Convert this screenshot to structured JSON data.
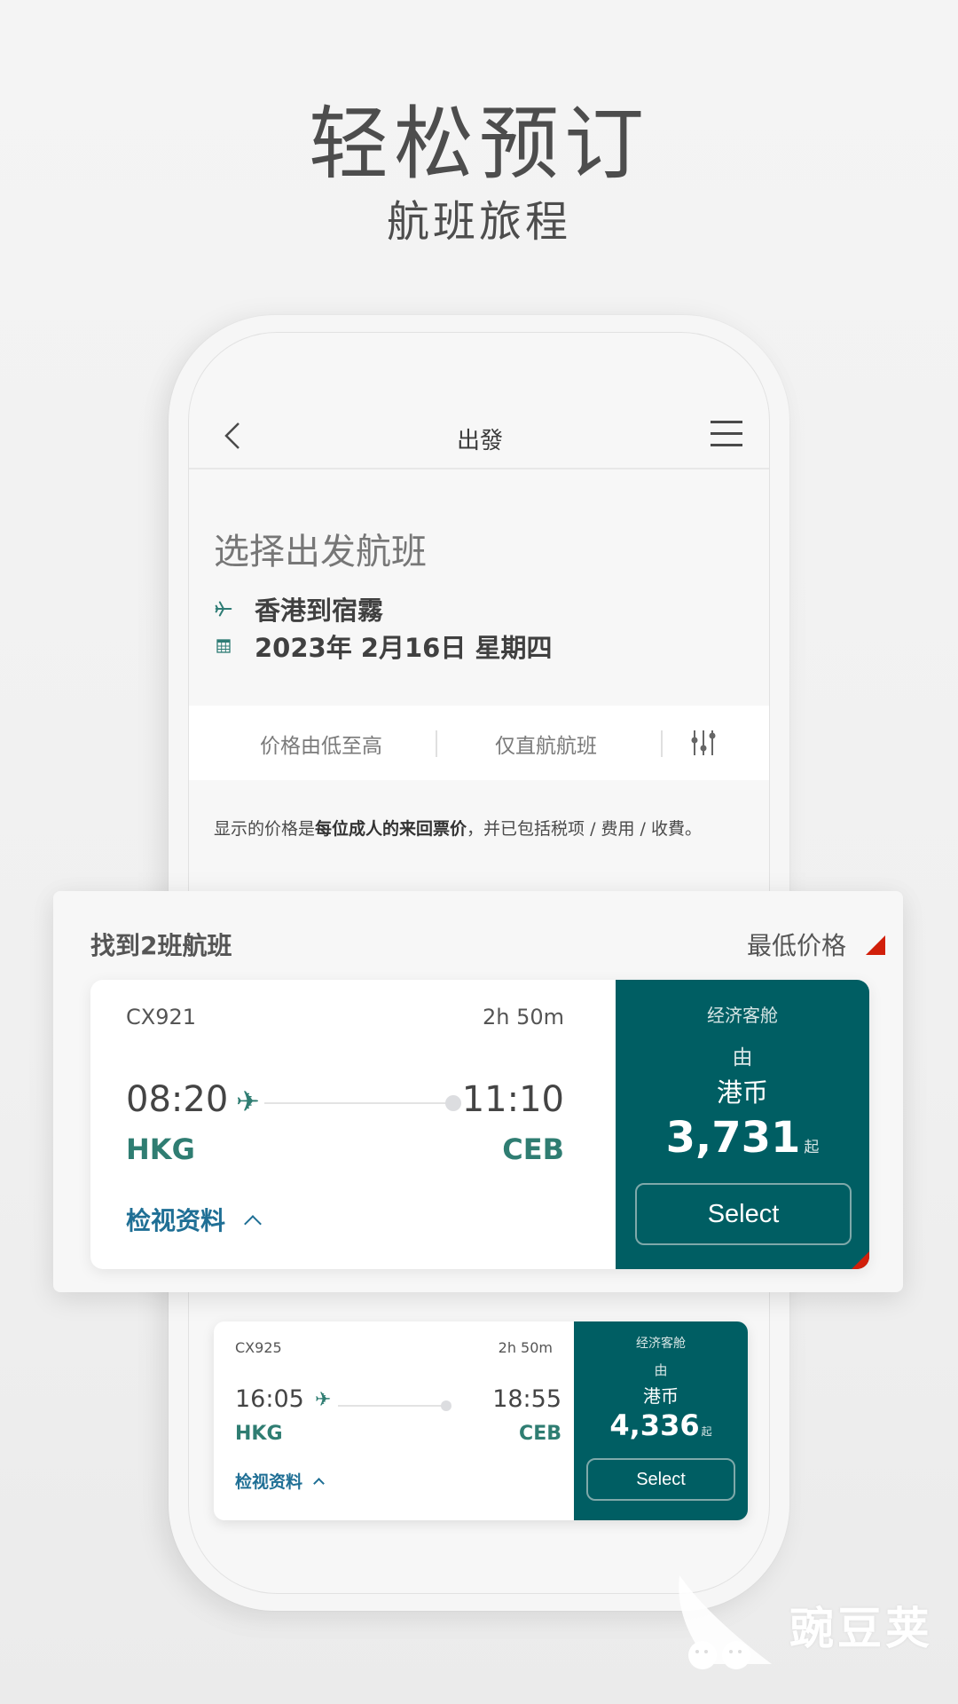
{
  "promo": {
    "title": "轻松预订",
    "subtitle": "航班旅程"
  },
  "nav": {
    "back_icon": "chevron-left-icon",
    "title": "出發",
    "menu_icon": "hamburger-menu-icon"
  },
  "page": {
    "title": "选择出发航班",
    "route": "香港到宿霧",
    "route_icon": "plane-icon",
    "date": "2023年 2月16日 星期四",
    "date_icon": "calendar-icon"
  },
  "filters": {
    "sort_label": "价格由低至高",
    "nonstop_label": "仅直航航班",
    "filter_icon": "sliders-icon"
  },
  "note": {
    "prefix": "显示的价格是",
    "bold": "每位成人的来回票价",
    "suffix": "，并已包括税项 / 费用 / 收費。"
  },
  "results": {
    "count_label": "找到2班航班",
    "sort_label": "最低价格"
  },
  "flights": [
    {
      "flight_no": "CX921",
      "duration": "2h 50m",
      "depart_time": "08:20",
      "arrive_time": "11:10",
      "origin": "HKG",
      "destination": "CEB",
      "details_label": "检视资料",
      "cabin": "经济客舱",
      "from_label": "由",
      "currency": "港币",
      "price": "3,731",
      "price_suffix": "起",
      "select_label": "Select"
    },
    {
      "flight_no": "CX925",
      "duration": "2h 50m",
      "depart_time": "16:05",
      "arrive_time": "18:55",
      "origin": "HKG",
      "destination": "CEB",
      "details_label": "检视资料",
      "cabin": "经济客舱",
      "from_label": "由",
      "currency": "港币",
      "price": "4,336",
      "price_suffix": "起",
      "select_label": "Select"
    }
  ],
  "colors": {
    "brand_teal": "#005e63",
    "accent_green": "#2f7d72",
    "link_blue": "#1f6f95",
    "corner_red": "#d11f0a"
  },
  "watermark": {
    "text": "豌豆荚"
  }
}
